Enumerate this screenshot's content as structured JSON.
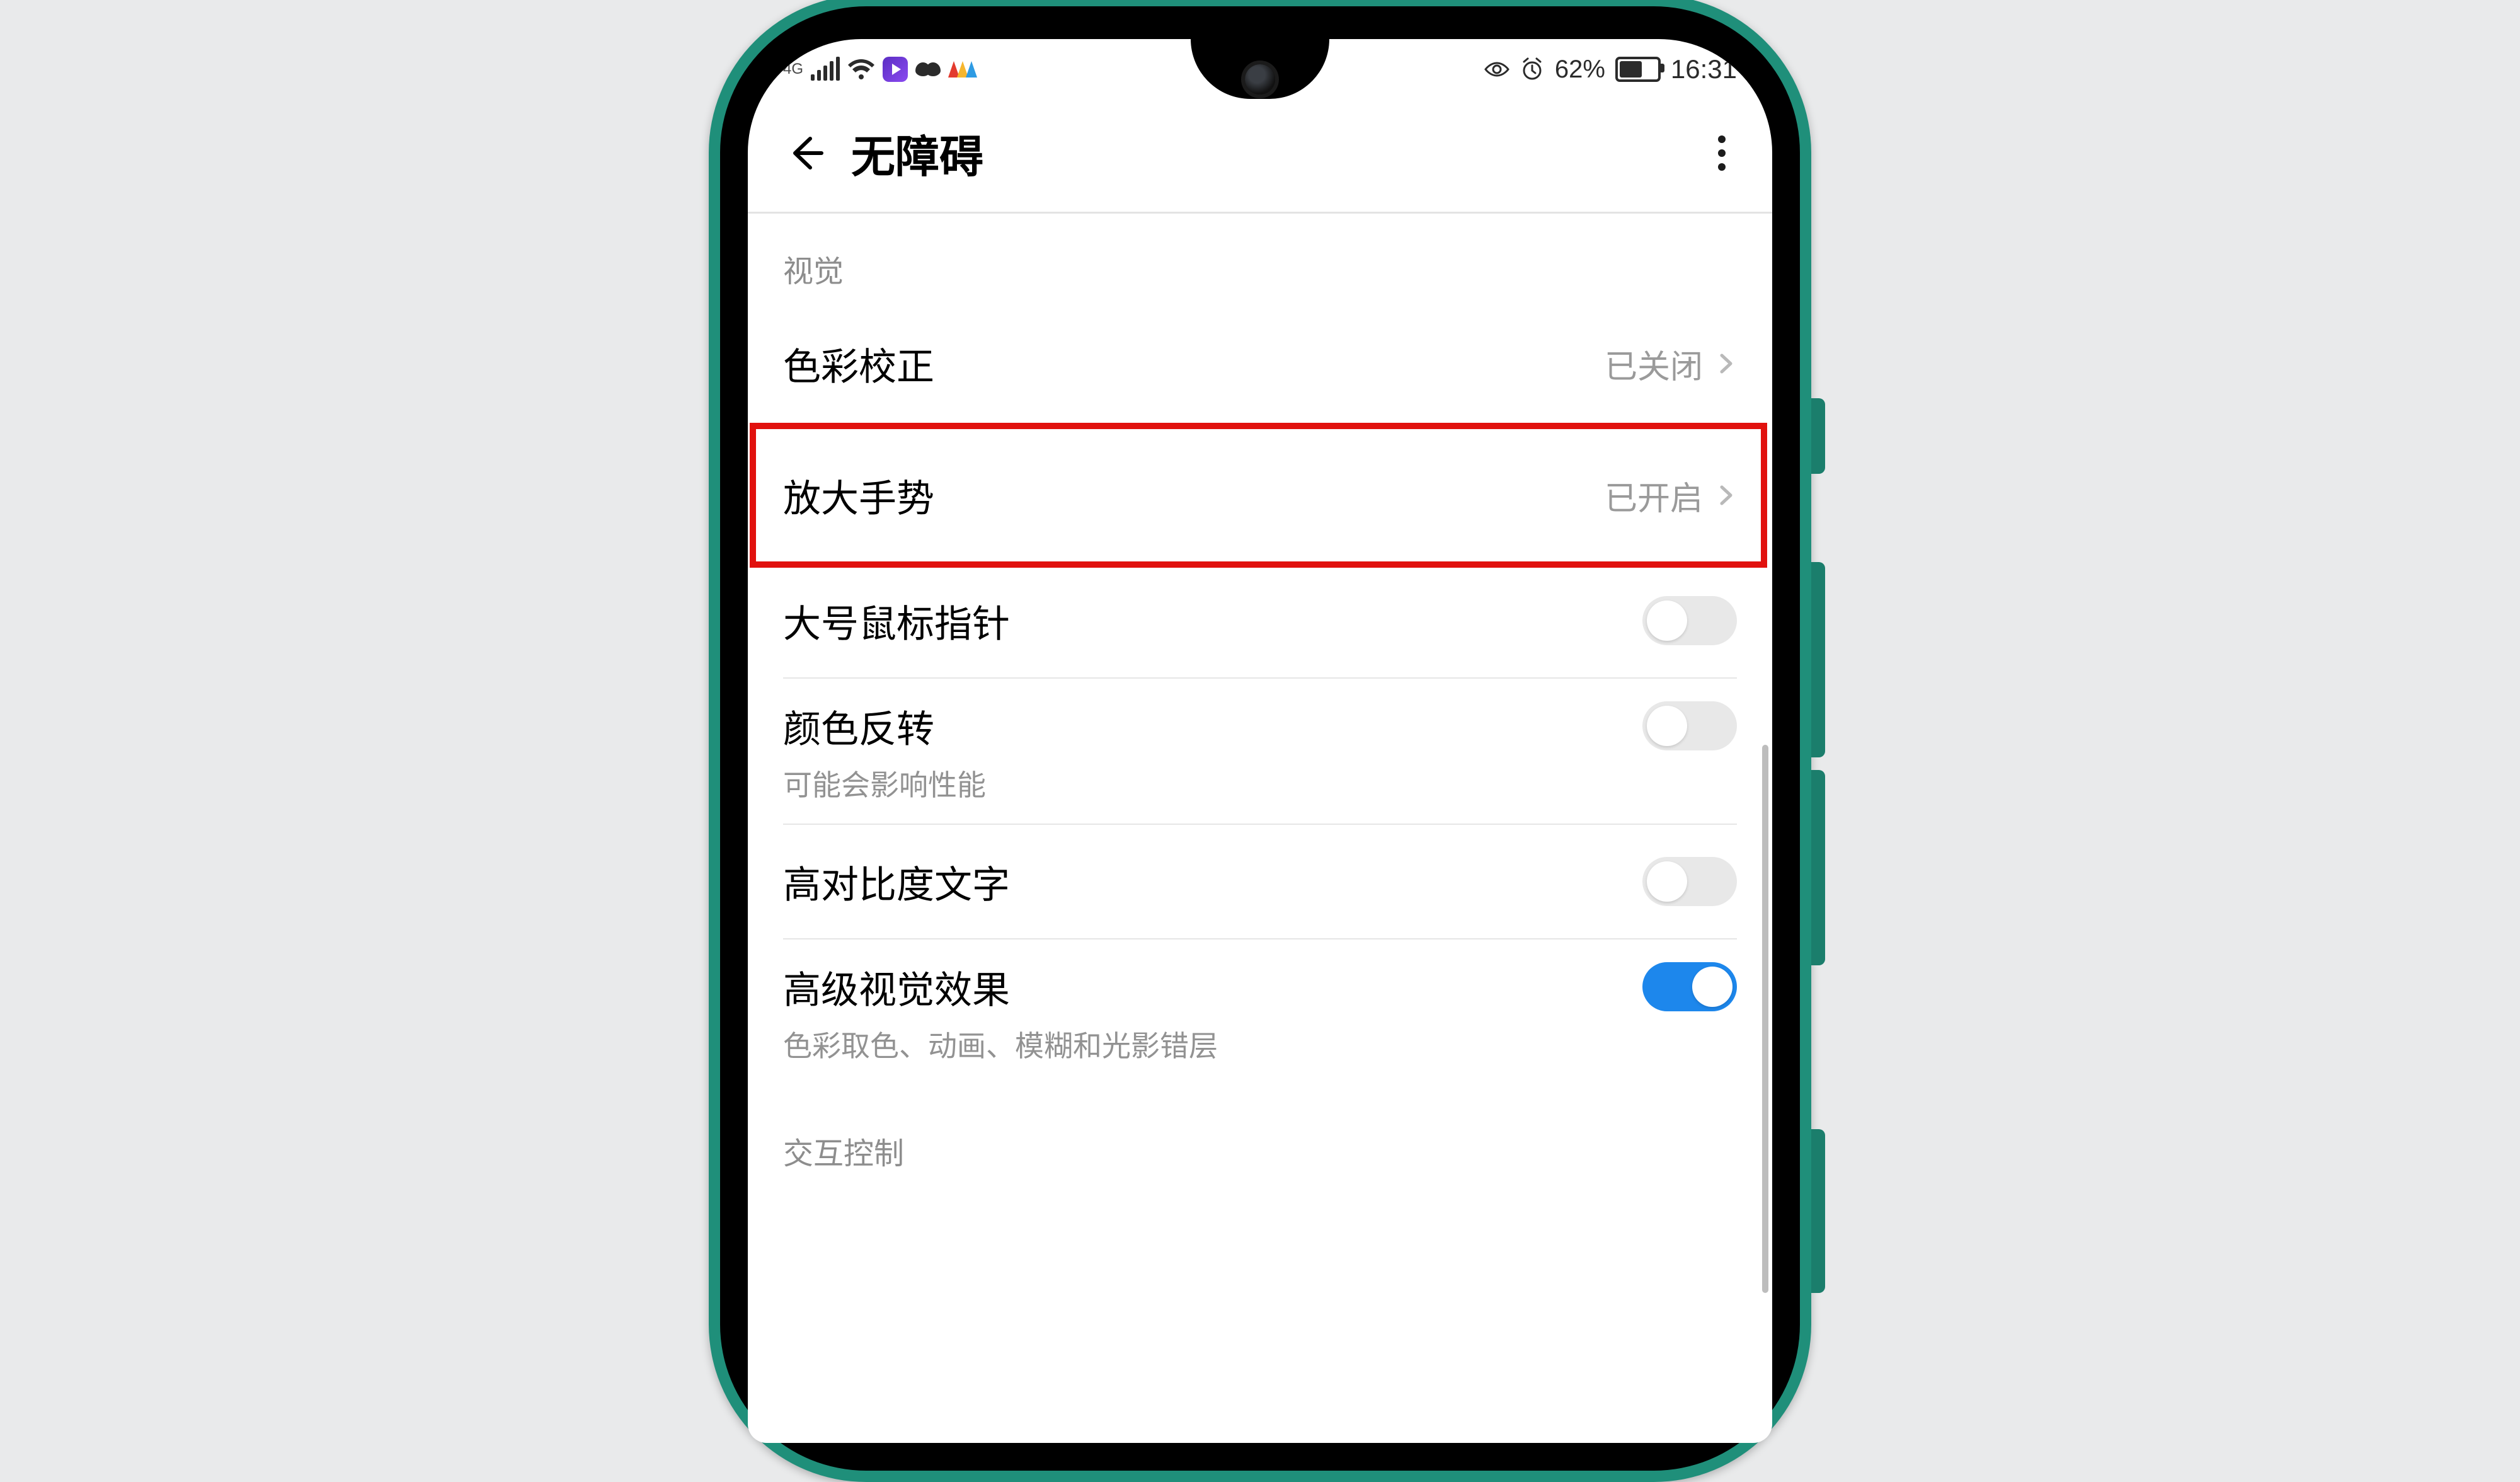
{
  "status": {
    "network_label": "4G",
    "battery_percent_text": "62%",
    "battery_fill_percent": 62,
    "time": "16:31"
  },
  "header": {
    "title": "无障碍"
  },
  "sections": {
    "visual_title": "视觉",
    "interaction_title": "交互控制"
  },
  "items": {
    "color_correction": {
      "label": "色彩校正",
      "value": "已关闭"
    },
    "magnification": {
      "label": "放大手势",
      "value": "已开启"
    },
    "large_pointer": {
      "label": "大号鼠标指针"
    },
    "color_inversion": {
      "label": "颜色反转",
      "subtitle": "可能会影响性能"
    },
    "high_contrast": {
      "label": "高对比度文字"
    },
    "advanced_visual": {
      "label": "高级视觉效果",
      "subtitle": "色彩取色、动画、模糊和光影错层"
    }
  },
  "toggles": {
    "large_pointer": false,
    "color_inversion": false,
    "high_contrast": false,
    "advanced_visual": true
  },
  "highlight": "magnification"
}
